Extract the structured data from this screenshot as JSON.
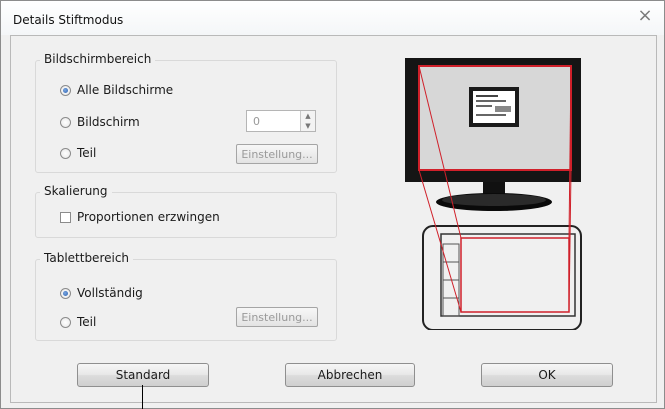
{
  "window": {
    "title": "Details Stiftmodus"
  },
  "bildschirmbereich": {
    "label": "Bildschirmbereich",
    "options": [
      {
        "label": "Alle Bildschirme",
        "selected": true
      },
      {
        "label": "Bildschirm",
        "selected": false
      },
      {
        "label": "Teil",
        "selected": false
      }
    ],
    "monitor_number": "0",
    "settings_button": "Einstellung..."
  },
  "skalierung": {
    "label": "Skalierung",
    "checkbox_label": "Proportionen erzwingen",
    "checked": false
  },
  "tablettbereich": {
    "label": "Tablettbereich",
    "options": [
      {
        "label": "Vollständig",
        "selected": true
      },
      {
        "label": "Teil",
        "selected": false
      }
    ],
    "settings_button": "Einstellung..."
  },
  "buttons": {
    "standard": "Standard",
    "cancel": "Abbrechen",
    "ok": "OK"
  },
  "colors": {
    "accent_red": "#d0202a",
    "dialog_bg": "#f0f0f0"
  }
}
